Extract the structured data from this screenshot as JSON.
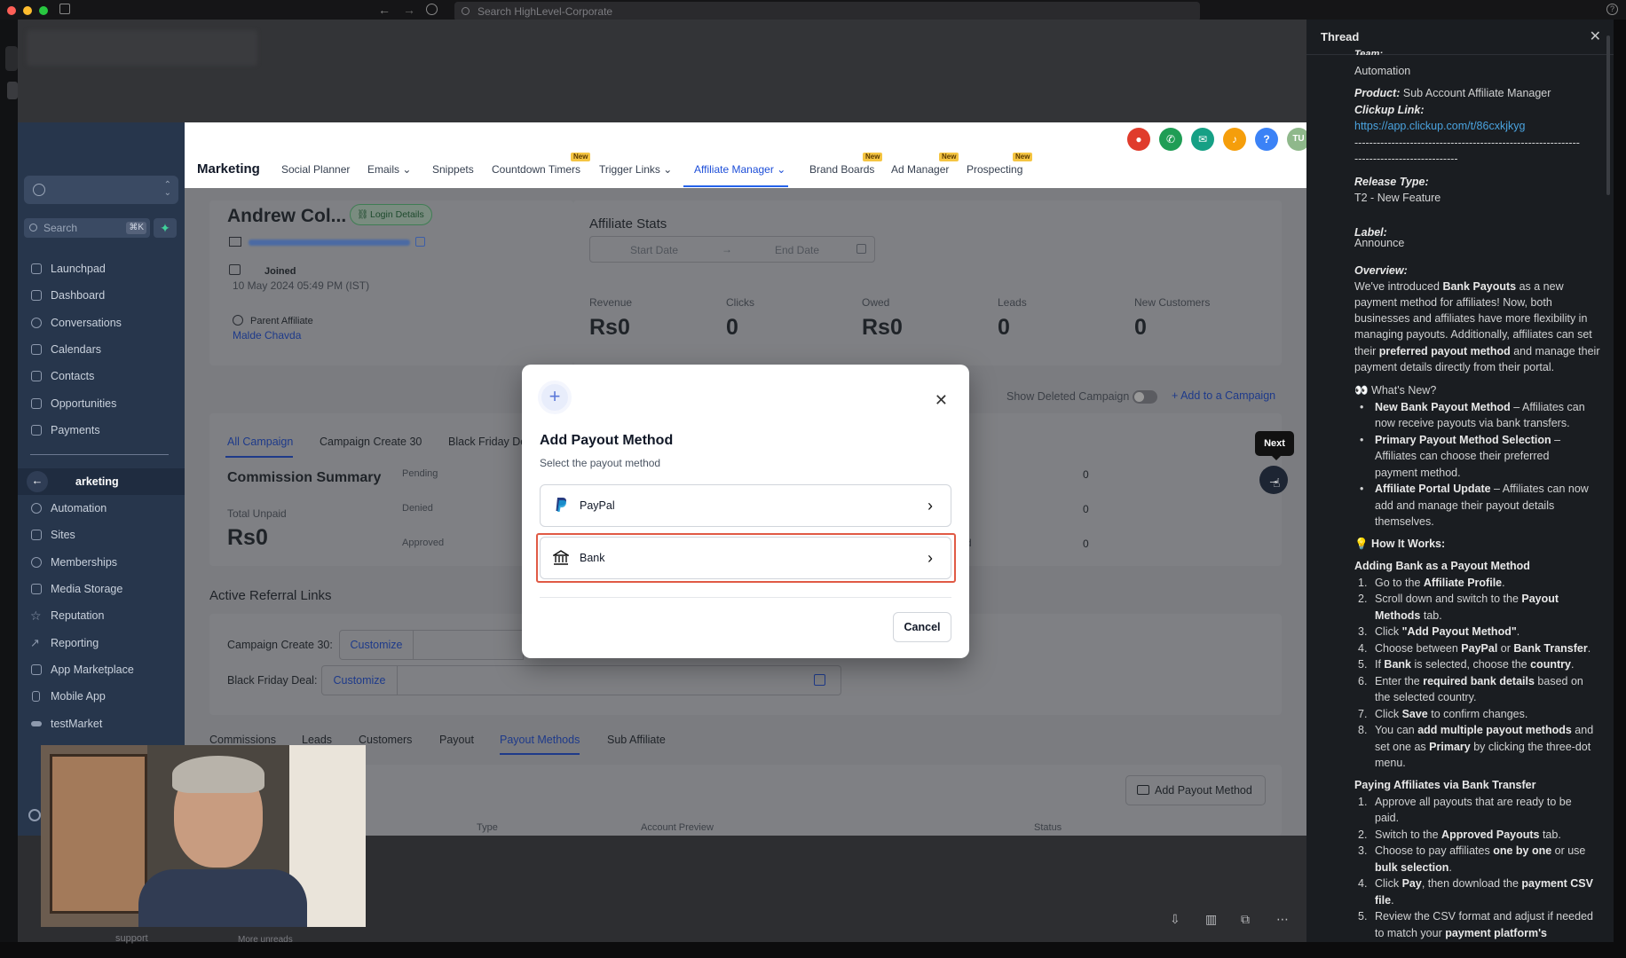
{
  "os": {
    "search_placeholder": "Search HighLevel-Corporate"
  },
  "sidebar": {
    "search_label": "Search",
    "search_shortcut": "⌘K",
    "items": [
      {
        "label": "Launchpad",
        "icon": "rocket-icon"
      },
      {
        "label": "Dashboard",
        "icon": "grid-icon"
      },
      {
        "label": "Conversations",
        "icon": "chat-icon"
      },
      {
        "label": "Calendars",
        "icon": "calendar-icon"
      },
      {
        "label": "Contacts",
        "icon": "contacts-icon"
      },
      {
        "label": "Opportunities",
        "icon": "funnel-icon"
      },
      {
        "label": "Payments",
        "icon": "payment-icon"
      }
    ],
    "items2": [
      {
        "label": "arketing",
        "icon": "megaphone-icon"
      },
      {
        "label": "Automation",
        "icon": "automation-icon"
      },
      {
        "label": "Sites",
        "icon": "globe-icon"
      },
      {
        "label": "Memberships",
        "icon": "membership-icon"
      },
      {
        "label": "Media Storage",
        "icon": "image-icon"
      },
      {
        "label": "Reputation",
        "icon": "star-icon"
      },
      {
        "label": "Reporting",
        "icon": "chart-icon"
      },
      {
        "label": "App Marketplace",
        "icon": "apps-icon"
      },
      {
        "label": "Mobile App",
        "icon": "phone-icon"
      },
      {
        "label": "testMarket",
        "icon": "app-icon"
      }
    ]
  },
  "header": {
    "brand": "Marketing",
    "nav": [
      {
        "label": "Social Planner",
        "new": false
      },
      {
        "label": "Emails",
        "new": false
      },
      {
        "label": "Snippets",
        "new": false
      },
      {
        "label": "Countdown Timers",
        "new": true
      },
      {
        "label": "Trigger Links",
        "new": false
      },
      {
        "label": "Affiliate Manager",
        "new": false
      },
      {
        "label": "Brand Boards",
        "new": true
      },
      {
        "label": "Ad Manager",
        "new": true
      },
      {
        "label": "Prospecting",
        "new": true
      }
    ],
    "new_badge": "New",
    "avatar": "TU"
  },
  "affiliate": {
    "name": "Andrew Col...",
    "login_details": "Login Details",
    "joined_label": "Joined",
    "joined_value": "10 May 2024 05:49 PM (IST)",
    "parent_label": "Parent Affiliate",
    "parent_value": "Malde Chavda"
  },
  "stats": {
    "title": "Affiliate Stats",
    "start_date": "Start Date",
    "end_date": "End Date",
    "items": [
      {
        "label": "Revenue",
        "value": "Rs0"
      },
      {
        "label": "Clicks",
        "value": "0"
      },
      {
        "label": "Owed",
        "value": "Rs0"
      },
      {
        "label": "Leads",
        "value": "0"
      },
      {
        "label": "New Customers",
        "value": "0"
      }
    ]
  },
  "campaign": {
    "show_deleted": "Show Deleted Campaign",
    "add": "Add to a Campaign",
    "tabs": [
      "All Campaign",
      "Campaign Create 30",
      "Black Friday De"
    ],
    "summary_title": "Commission Summary",
    "total_unpaid_label": "Total Unpaid",
    "total_unpaid_value": "Rs0",
    "statuses": [
      "Pending",
      "Denied",
      "Approved"
    ],
    "right_values": [
      "0",
      "0",
      "0"
    ],
    "right_fragment": "d"
  },
  "referral": {
    "title": "Active Referral Links",
    "rows": [
      {
        "label": "Campaign Create 30:",
        "action": "Customize"
      },
      {
        "label": "Black Friday Deal:",
        "action": "Customize"
      }
    ]
  },
  "bottom_tabs": [
    "Commissions",
    "Leads",
    "Customers",
    "Payout",
    "Payout Methods",
    "Sub Affiliate"
  ],
  "payout_table": {
    "add_button": "Add Payout Method",
    "columns": [
      "Type",
      "Account Preview",
      "Status"
    ]
  },
  "tooltip": "Next",
  "modal": {
    "title": "Add Payout Method",
    "subtitle": "Select the payout method",
    "options": [
      "PayPal",
      "Bank"
    ],
    "cancel": "Cancel"
  },
  "thread": {
    "title": "Thread",
    "team_label": "Team:",
    "team_value": "Automation",
    "product_label": "Product:",
    "product_value": "Sub Account Affiliate Manager",
    "clickup_label": "Clickup Link:",
    "clickup_url": "https://app.clickup.com/t/86cxkjkyg",
    "dashes1": "-------------------------------------------------------------",
    "dashes2": "----------------------------",
    "release_label": "Release Type:",
    "release_value": "T2 - New Feature",
    "label_label": "Label:",
    "label_value": "Announce",
    "overview_label": "Overview:",
    "overview_lines": [
      [
        "We've introduced ",
        "Bank Payouts",
        " as a new"
      ],
      [
        "payment method for affiliates! Now, both",
        "",
        ""
      ],
      [
        "businesses and affiliates have more flexibility in",
        "",
        ""
      ],
      [
        "managing payouts. Additionally, affiliates can set",
        "",
        ""
      ],
      [
        "their ",
        "preferred payout method",
        " and manage their"
      ],
      [
        "payment details directly from their portal.",
        "",
        ""
      ]
    ],
    "whats_new": "What's New?",
    "whats_new_items": [
      [
        [
          "New Bank Payout Method",
          " – Affiliates can"
        ],
        [
          "now receive payouts via bank transfers.",
          ""
        ]
      ],
      [
        [
          "Primary Payout Method Selection",
          " –"
        ],
        [
          "Affiliates can choose their preferred",
          ""
        ],
        [
          "payment method.",
          ""
        ]
      ],
      [
        [
          "Affiliate Portal Update",
          " – Affiliates can now"
        ],
        [
          "add and manage their payout details",
          ""
        ],
        [
          "themselves.",
          ""
        ]
      ]
    ],
    "how_it_works": "How It Works:",
    "adding_title": "Adding Bank as a Payout Method",
    "adding_steps": [
      [
        "Go to the ",
        "Affiliate Profile",
        "."
      ],
      [
        "Scroll down and switch to the ",
        "Payout",
        ""
      ],
      [
        "",
        "Methods",
        " tab."
      ],
      [
        "Click ",
        "\"Add Payout Method\"",
        "."
      ],
      [
        "Choose between ",
        "PayPal",
        " or ",
        "Bank Transfer",
        "."
      ],
      [
        "If ",
        "Bank",
        " is selected, choose the ",
        "country",
        "."
      ],
      [
        "Enter the ",
        "required bank details",
        " based on"
      ],
      [
        "the selected country.",
        "",
        ""
      ],
      [
        "Click ",
        "Save",
        " to confirm changes."
      ],
      [
        "You can ",
        "add multiple payout methods",
        " and"
      ],
      [
        "set one as ",
        "Primary",
        " by clicking the three-dot"
      ],
      [
        "menu.",
        "",
        ""
      ]
    ],
    "paying_title": "Paying Affiliates via Bank Transfer",
    "paying_steps": [
      [
        "Approve all payouts that are ready to be",
        "",
        ""
      ],
      [
        "paid.",
        "",
        ""
      ],
      [
        "Switch to the ",
        "Approved Payouts",
        " tab."
      ],
      [
        "Choose to pay affiliates ",
        "one by one",
        " or use"
      ],
      [
        "",
        "bulk selection",
        "."
      ],
      [
        "Click ",
        "Pay",
        ", then download the ",
        "payment CSV",
        ""
      ],
      [
        "",
        "file",
        "."
      ],
      [
        "Review the CSV format and adjust if needed",
        "",
        ""
      ],
      [
        "to match your ",
        "payment platform's",
        ""
      ]
    ]
  },
  "bottom": {
    "support": "support",
    "more_unreads": "More unreads"
  }
}
